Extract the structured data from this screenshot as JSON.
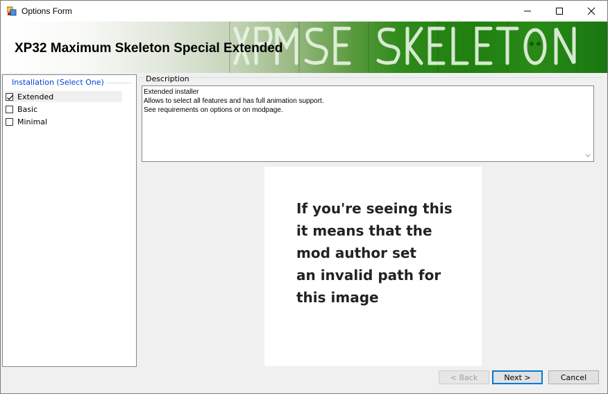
{
  "window": {
    "title": "Options Form",
    "controls": [
      "minimize-icon",
      "maximize-icon",
      "close-icon"
    ]
  },
  "banner": {
    "title": "XP32 Maximum Skeleton Special Extended",
    "art_text": "XPMSE SKELETON"
  },
  "installation": {
    "legend": "Installation (Select One)",
    "options": [
      {
        "label": "Extended",
        "checked": true,
        "selected": true
      },
      {
        "label": "Basic",
        "checked": false,
        "selected": false
      },
      {
        "label": "Minimal",
        "checked": false,
        "selected": false
      }
    ]
  },
  "description": {
    "label": "Description",
    "lines": [
      "Extended installer",
      "Allows to select all features and has full animation support.",
      "See requirements on options or on modpage."
    ]
  },
  "image_placeholder": {
    "lines": [
      "If you're seeing this",
      "it means that the",
      "mod author set",
      "an invalid path for",
      "this image"
    ]
  },
  "buttons": {
    "back": "< Back",
    "next": "Next >",
    "cancel": "Cancel"
  },
  "colors": {
    "legend": "#0046d5",
    "banner_green": "#1f7f0f",
    "default_button_border": "#0078d7"
  }
}
